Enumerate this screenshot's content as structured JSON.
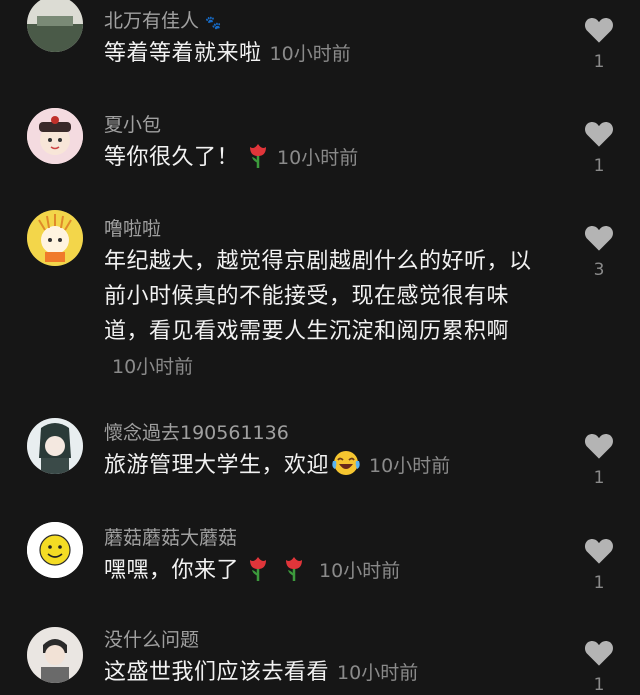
{
  "comments": [
    {
      "user": "北万有佳人",
      "text": "等着等着就来啦",
      "time": "10小时前",
      "likes": "1"
    },
    {
      "user": "夏小包",
      "text": "等你很久了！",
      "time": "10小时前",
      "likes": "1"
    },
    {
      "user": "噜啦啦",
      "text": "年纪越大，越觉得京剧越剧什么的好听，以前小时候真的不能接受，现在感觉很有味道，看见看戏需要人生沉淀和阅历累积啊",
      "time": "10小时前",
      "likes": "3"
    },
    {
      "user": "懷念過去190561136",
      "text": "旅游管理大学生，欢迎",
      "time": "10小时前",
      "likes": "1"
    },
    {
      "user": "蘑菇蘑菇大蘑菇",
      "text": "嘿嘿，你来了",
      "time": "10小时前",
      "likes": "1"
    },
    {
      "user": "没什么问题",
      "text": "这盛世我们应该去看看",
      "time": "10小时前",
      "likes": "1"
    }
  ],
  "icons": {
    "like": "heart-icon",
    "rose": "rose-emoji",
    "laugh": "laughing-tears-emoji",
    "paw": "paw-icon"
  },
  "colors": {
    "background": "#161616",
    "username": "#a0a0a0",
    "text": "#f2f2f2",
    "meta": "#8a8a8a",
    "heart": "#b4b4b4"
  }
}
